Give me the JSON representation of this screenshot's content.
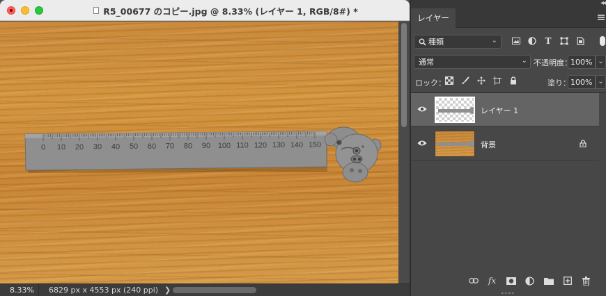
{
  "window": {
    "title": "R5_00677 のコピー.jpg @ 8.33% (レイヤー 1, RGB/8#) *"
  },
  "canvas": {
    "ruler_ticks": [
      "0",
      "10",
      "20",
      "30",
      "40",
      "50",
      "60",
      "70",
      "80",
      "90",
      "100",
      "110",
      "120",
      "130",
      "140",
      "150"
    ]
  },
  "status": {
    "zoom": "8.33%",
    "doc_info": "6829 px x 4553 px (240 ppi)",
    "arrow": "❯"
  },
  "panel": {
    "tab_label": "レイヤー",
    "filter_label": "種類",
    "blend_mode": "通常",
    "opacity_label": "不透明度：",
    "opacity_value": "100%",
    "lock_label": "ロック：",
    "fill_label": "塗り：",
    "fill_value": "100%",
    "layers": [
      {
        "name": "レイヤー 1",
        "selected": true,
        "locked": false
      },
      {
        "name": "背景",
        "selected": false,
        "locked": true
      }
    ],
    "bottom_icons": [
      "link-icon",
      "fx-icon",
      "mask-icon",
      "adjustment-icon",
      "folder-icon",
      "new-layer-icon",
      "trash-icon"
    ],
    "fx_label": "fx"
  },
  "colors": {
    "wood": "#c98a3c",
    "ruler": "#8f8f8f",
    "panel_bg": "#474747",
    "selected_layer": "#646464"
  }
}
